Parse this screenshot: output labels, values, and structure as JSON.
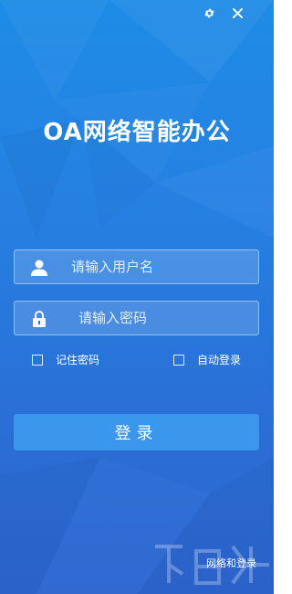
{
  "window": {
    "settings_icon": "gear-icon",
    "close_icon": "close-icon"
  },
  "app": {
    "title": "OA网络智能办公"
  },
  "login": {
    "username_placeholder": "请输入用户名",
    "username_value": "",
    "username_icon": "user-icon",
    "password_placeholder": "请输入密码",
    "password_value": "",
    "password_icon": "lock-icon",
    "remember_label": "记住密码",
    "remember_checked": false,
    "auto_login_label": "自动登录",
    "auto_login_checked": false,
    "submit_label": "登录"
  },
  "watermark": {
    "text": "网络和登录"
  },
  "colors": {
    "background_top": "#1e8ce6",
    "background_bottom": "#2d66d0",
    "button": "#3a97ec",
    "text": "#ffffff"
  }
}
